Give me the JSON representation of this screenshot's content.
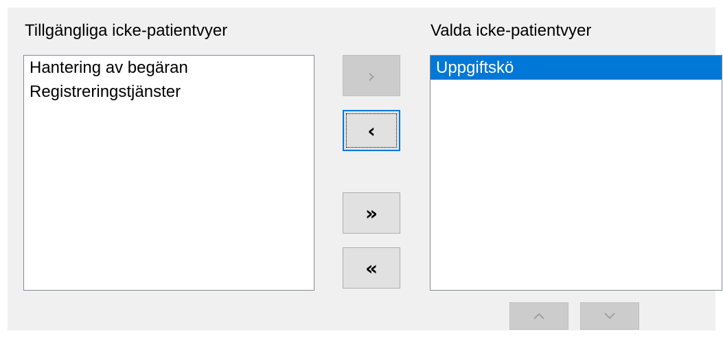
{
  "available": {
    "heading": "Tillgängliga icke-patientvyer",
    "items": [
      "Hantering av begäran",
      "Registreringstjänster"
    ]
  },
  "selected": {
    "heading": "Valda icke-patientvyer",
    "items": [
      "Uppgiftskö"
    ],
    "selected_index": 0
  },
  "buttons": {
    "move_right": "›",
    "move_left": "‹",
    "move_all_right": "»",
    "move_all_left": "«"
  },
  "icons": {
    "move_up": "chevron-up-icon",
    "move_down": "chevron-down-icon"
  },
  "colors": {
    "selection": "#0078d7",
    "panel_background": "#f0f0f0"
  }
}
